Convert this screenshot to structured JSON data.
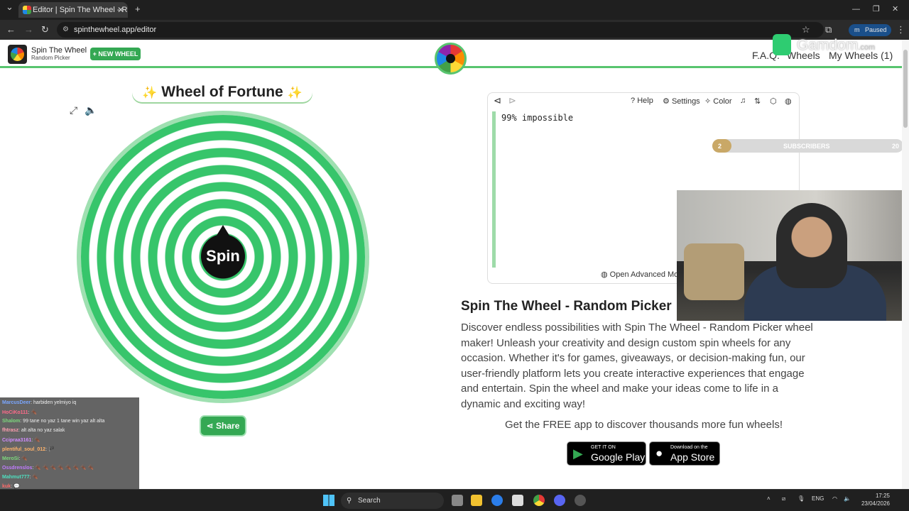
{
  "browser": {
    "tab_title": "Editor | Spin The Wheel - Rand",
    "url": "spinthewheel.app/editor",
    "profile_status": "Paused",
    "profile_initial": "m"
  },
  "site": {
    "brand_name": "Spin The Wheel",
    "brand_sub": "Random Picker",
    "new_wheel_label": "+ NEW WHEEL",
    "nav": {
      "faq": "F.A.Q.",
      "wheels": "Wheels",
      "my_wheels": "My Wheels (1)"
    }
  },
  "overlay": {
    "gamdom": "Gamdom",
    "gamdom_suffix": ".com",
    "subscribers_label": "SUBSCRIBERS",
    "subscribers_current": "2",
    "subscribers_goal": "20",
    "subscribers_progress": 0.1
  },
  "wheel": {
    "title": "Wheel of Fortune",
    "spin_label": "Spin",
    "share_label": "Share"
  },
  "editor": {
    "help_label": "Help",
    "settings_label": "Settings",
    "color_label": "Color",
    "entries": "99% impossible",
    "advanced_label": "Open Advanced Mo"
  },
  "description": {
    "title": "Spin The Wheel - Random Picker",
    "body": "Discover endless possibilities with Spin The Wheel - Random Picker wheel maker! Unleash your creativity and design custom spin wheels for any occasion. Whether it's for games, giveaways, or decision-making fun, our user-friendly platform lets you create interactive experiences that engage and entertain. Spin the wheel and make your ideas come to life in a dynamic and exciting way!",
    "free_app": "Get the FREE app to discover thousands more fun wheels!",
    "google_small": "GET IT ON",
    "google_big": "Google Play",
    "apple_small": "Download on the",
    "apple_big": "App Store"
  },
  "chat": [
    {
      "name": "MarcusDeer",
      "msg": "harbiden yelmiyo iq",
      "color": "#7aa6ff"
    },
    {
      "name": "HoCiKo111",
      "msg": "🪳",
      "color": "#ff6b8a"
    },
    {
      "name": "Shalom",
      "msg": "99 tane no yaz 1 tane win yaz alt alta",
      "color": "#7dd97d"
    },
    {
      "name": "fhtrasz",
      "msg": "alt alta no yaz salak",
      "color": "#ff9fb0"
    },
    {
      "name": "Ccipraa3161",
      "msg": "🪳",
      "color": "#d18cff"
    },
    {
      "name": "plentiful_soul_012",
      "msg": "🏴",
      "color": "#ffb36b"
    },
    {
      "name": "MeroSi",
      "msg": "🪳",
      "color": "#7dd97d"
    },
    {
      "name": "Ossdrenslos",
      "msg": "🪳 🪳 🪳 🪳 🪳 🪳 🪳 🪳",
      "color": "#c07bff"
    },
    {
      "name": "Mahmut777",
      "msg": "🪳",
      "color": "#4ee0c0"
    },
    {
      "name": "kuk",
      "msg": "💬",
      "color": "#ff6b6b"
    },
    {
      "name": "dracbey",
      "msg": "🪳",
      "color": "#ffffff"
    }
  ],
  "taskbar": {
    "search": "Search",
    "lang": "ENG",
    "time": "17:25",
    "date": "23/04/2026"
  },
  "colors": {
    "accent": "#34a853",
    "wheel_green": "#37c56b"
  }
}
